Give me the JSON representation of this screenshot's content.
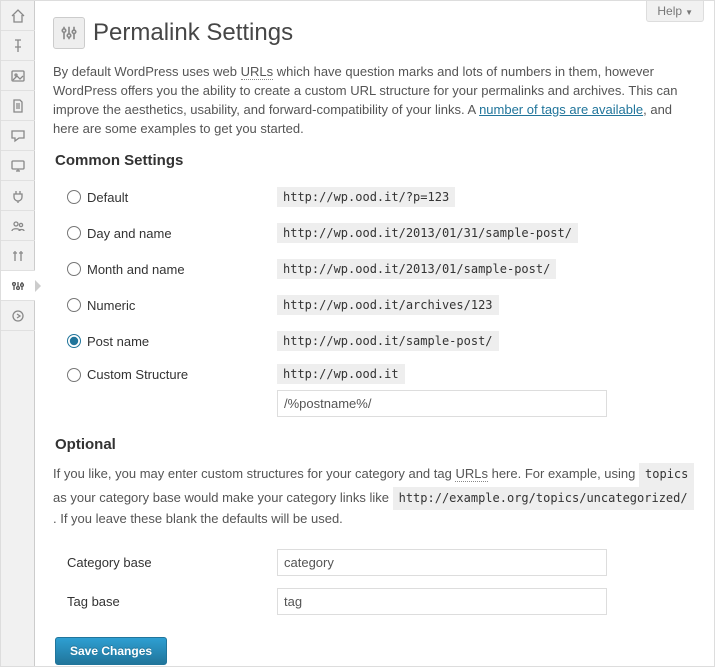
{
  "help_label": "Help",
  "page_title": "Permalink Settings",
  "intro": {
    "pre": "By default WordPress uses web ",
    "urls": "URLs",
    "mid": " which have question marks and lots of numbers in them, however WordPress offers you the ability to create a custom URL structure for your permalinks and archives. This can improve the aesthetics, usability, and forward-compatibility of your links. A ",
    "link": "number of tags are available",
    "post": ", and here are some examples to get you started."
  },
  "common_heading": "Common Settings",
  "options": {
    "default": {
      "label": "Default",
      "example": "http://wp.ood.it/?p=123"
    },
    "dayname": {
      "label": "Day and name",
      "example": "http://wp.ood.it/2013/01/31/sample-post/"
    },
    "monthname": {
      "label": "Month and name",
      "example": "http://wp.ood.it/2013/01/sample-post/"
    },
    "numeric": {
      "label": "Numeric",
      "example": "http://wp.ood.it/archives/123"
    },
    "postname": {
      "label": "Post name",
      "example": "http://wp.ood.it/sample-post/"
    },
    "custom": {
      "label": "Custom Structure",
      "prefix": "http://wp.ood.it",
      "value": "/%postname%/"
    }
  },
  "optional_heading": "Optional",
  "optional_intro": {
    "pre": "If you like, you may enter custom structures for your category and tag ",
    "urls": "URLs",
    "mid": " here. For example, using ",
    "code1": "topics",
    "mid2": " as your category base would make your category links like ",
    "code2": "http://example.org/topics/uncategorized/",
    "post": " . If you leave these blank the defaults will be used."
  },
  "category_base": {
    "label": "Category base",
    "value": "category"
  },
  "tag_base": {
    "label": "Tag base",
    "value": "tag"
  },
  "save_label": "Save Changes"
}
